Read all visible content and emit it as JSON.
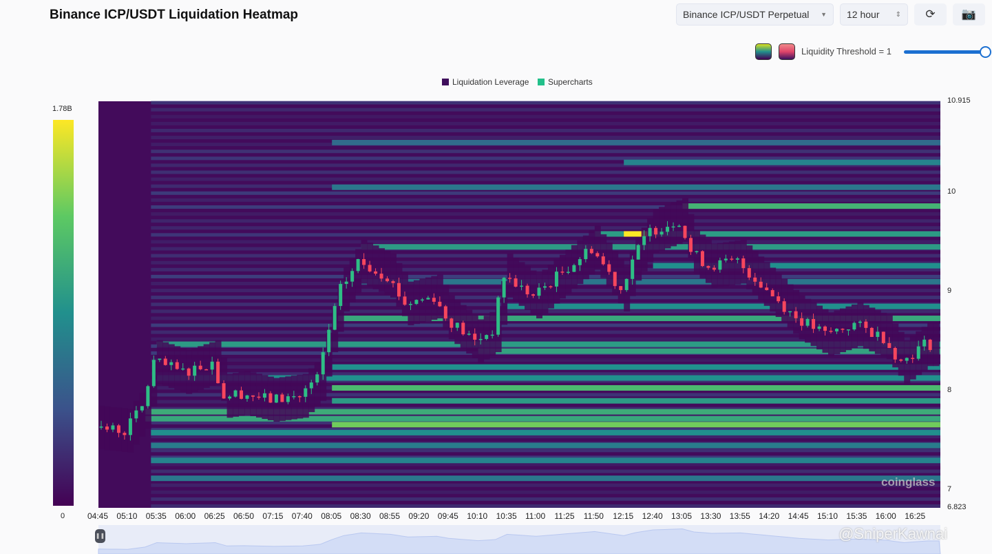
{
  "header": {
    "title": "Binance ICP/USDT Liquidation Heatmap",
    "pair_select": "Binance ICP/USDT Perpetual",
    "range_select": "12 hour",
    "refresh_icon": "refresh-icon",
    "camera_icon": "camera-icon",
    "threshold_label": "Liquidity Threshold = 1",
    "threshold_value": 1
  },
  "legend": {
    "items": [
      {
        "label": "Liquidation Leverage",
        "color": "#3f0f5c"
      },
      {
        "label": "Supercharts",
        "color": "#22c08a"
      }
    ]
  },
  "colorbar": {
    "max_label": "1.78B",
    "min_label": "0",
    "colors": [
      "#440154",
      "#3b528b",
      "#21908d",
      "#5dc963",
      "#fde725"
    ]
  },
  "watermark": "coinglass",
  "overlay_watermark": "@SniperKawnai",
  "chart_data": {
    "type": "heatmap",
    "title": "Binance ICP/USDT Liquidation Heatmap",
    "x_ticks": [
      "04:45",
      "05:10",
      "05:35",
      "06:00",
      "06:25",
      "06:50",
      "07:15",
      "07:40",
      "08:05",
      "08:30",
      "08:55",
      "09:20",
      "09:45",
      "10:10",
      "10:35",
      "11:00",
      "11:25",
      "11:50",
      "12:15",
      "12:40",
      "13:05",
      "13:30",
      "13:55",
      "14:20",
      "14:45",
      "15:10",
      "15:35",
      "16:00",
      "16:25"
    ],
    "y_ticks": [
      "10.915",
      "10",
      "9",
      "8",
      "7",
      "6.823"
    ],
    "ylim": [
      6.823,
      10.915
    ],
    "price_path": [
      [
        "04:45",
        7.63
      ],
      [
        "05:10",
        7.6
      ],
      [
        "05:25",
        7.84
      ],
      [
        "05:35",
        8.29
      ],
      [
        "06:00",
        8.19
      ],
      [
        "06:25",
        8.29
      ],
      [
        "06:35",
        7.95
      ],
      [
        "06:50",
        7.98
      ],
      [
        "07:15",
        7.91
      ],
      [
        "07:40",
        7.95
      ],
      [
        "07:55",
        8.12
      ],
      [
        "08:05",
        8.61
      ],
      [
        "08:15",
        9.02
      ],
      [
        "08:30",
        9.3
      ],
      [
        "08:55",
        9.16
      ],
      [
        "09:10",
        8.88
      ],
      [
        "09:35",
        8.95
      ],
      [
        "09:45",
        8.74
      ],
      [
        "10:10",
        8.5
      ],
      [
        "10:25",
        8.61
      ],
      [
        "10:35",
        9.16
      ],
      [
        "11:00",
        8.95
      ],
      [
        "11:25",
        9.2
      ],
      [
        "11:50",
        9.44
      ],
      [
        "12:15",
        9.02
      ],
      [
        "12:25",
        9.33
      ],
      [
        "12:40",
        9.61
      ],
      [
        "13:05",
        9.72
      ],
      [
        "13:15",
        9.4
      ],
      [
        "13:30",
        9.26
      ],
      [
        "13:55",
        9.3
      ],
      [
        "14:20",
        9.02
      ],
      [
        "14:45",
        8.74
      ],
      [
        "15:10",
        8.57
      ],
      [
        "15:35",
        8.67
      ],
      [
        "16:00",
        8.54
      ],
      [
        "16:15",
        8.29
      ],
      [
        "16:35",
        8.47
      ]
    ],
    "liquidity_bands": [
      {
        "price": 7.66,
        "from": "08:05",
        "intensity": 0.78
      },
      {
        "price": 7.72,
        "from": "05:25",
        "intensity": 0.6
      },
      {
        "price": 7.79,
        "from": "05:25",
        "intensity": 0.62
      },
      {
        "price": 7.58,
        "from": "05:30",
        "intensity": 0.5
      },
      {
        "price": 7.45,
        "from": "05:30",
        "intensity": 0.42
      },
      {
        "price": 7.3,
        "from": "05:30",
        "intensity": 0.45
      },
      {
        "price": 7.12,
        "from": "05:30",
        "intensity": 0.4
      },
      {
        "price": 7.9,
        "from": "08:05",
        "intensity": 0.55
      },
      {
        "price": 8.03,
        "from": "08:05",
        "intensity": 0.68
      },
      {
        "price": 8.13,
        "from": "05:35",
        "intensity": 0.5
      },
      {
        "price": 8.24,
        "from": "08:05",
        "intensity": 0.5
      },
      {
        "price": 8.4,
        "from": "10:10",
        "intensity": 0.58
      },
      {
        "price": 8.47,
        "from": "05:35",
        "intensity": 0.55
      },
      {
        "price": 8.73,
        "from": "08:10",
        "intensity": 0.6
      },
      {
        "price": 8.85,
        "from": "10:35",
        "intensity": 0.5
      },
      {
        "price": 9.1,
        "from": "08:30",
        "intensity": 0.4
      },
      {
        "price": 9.26,
        "from": "12:40",
        "intensity": 0.5
      },
      {
        "price": 9.45,
        "from": "08:30",
        "intensity": 0.55
      },
      {
        "price": 9.58,
        "from": "11:50",
        "intensity": 0.55
      },
      {
        "price": 9.86,
        "from": "13:05",
        "intensity": 0.65
      },
      {
        "price": 10.05,
        "from": "08:05",
        "intensity": 0.4
      },
      {
        "price": 10.3,
        "from": "12:15",
        "intensity": 0.45
      },
      {
        "price": 10.5,
        "from": "08:05",
        "intensity": 0.35
      },
      {
        "price": 9.58,
        "from": "12:15",
        "to": "12:35",
        "intensity": 1.0
      }
    ]
  }
}
